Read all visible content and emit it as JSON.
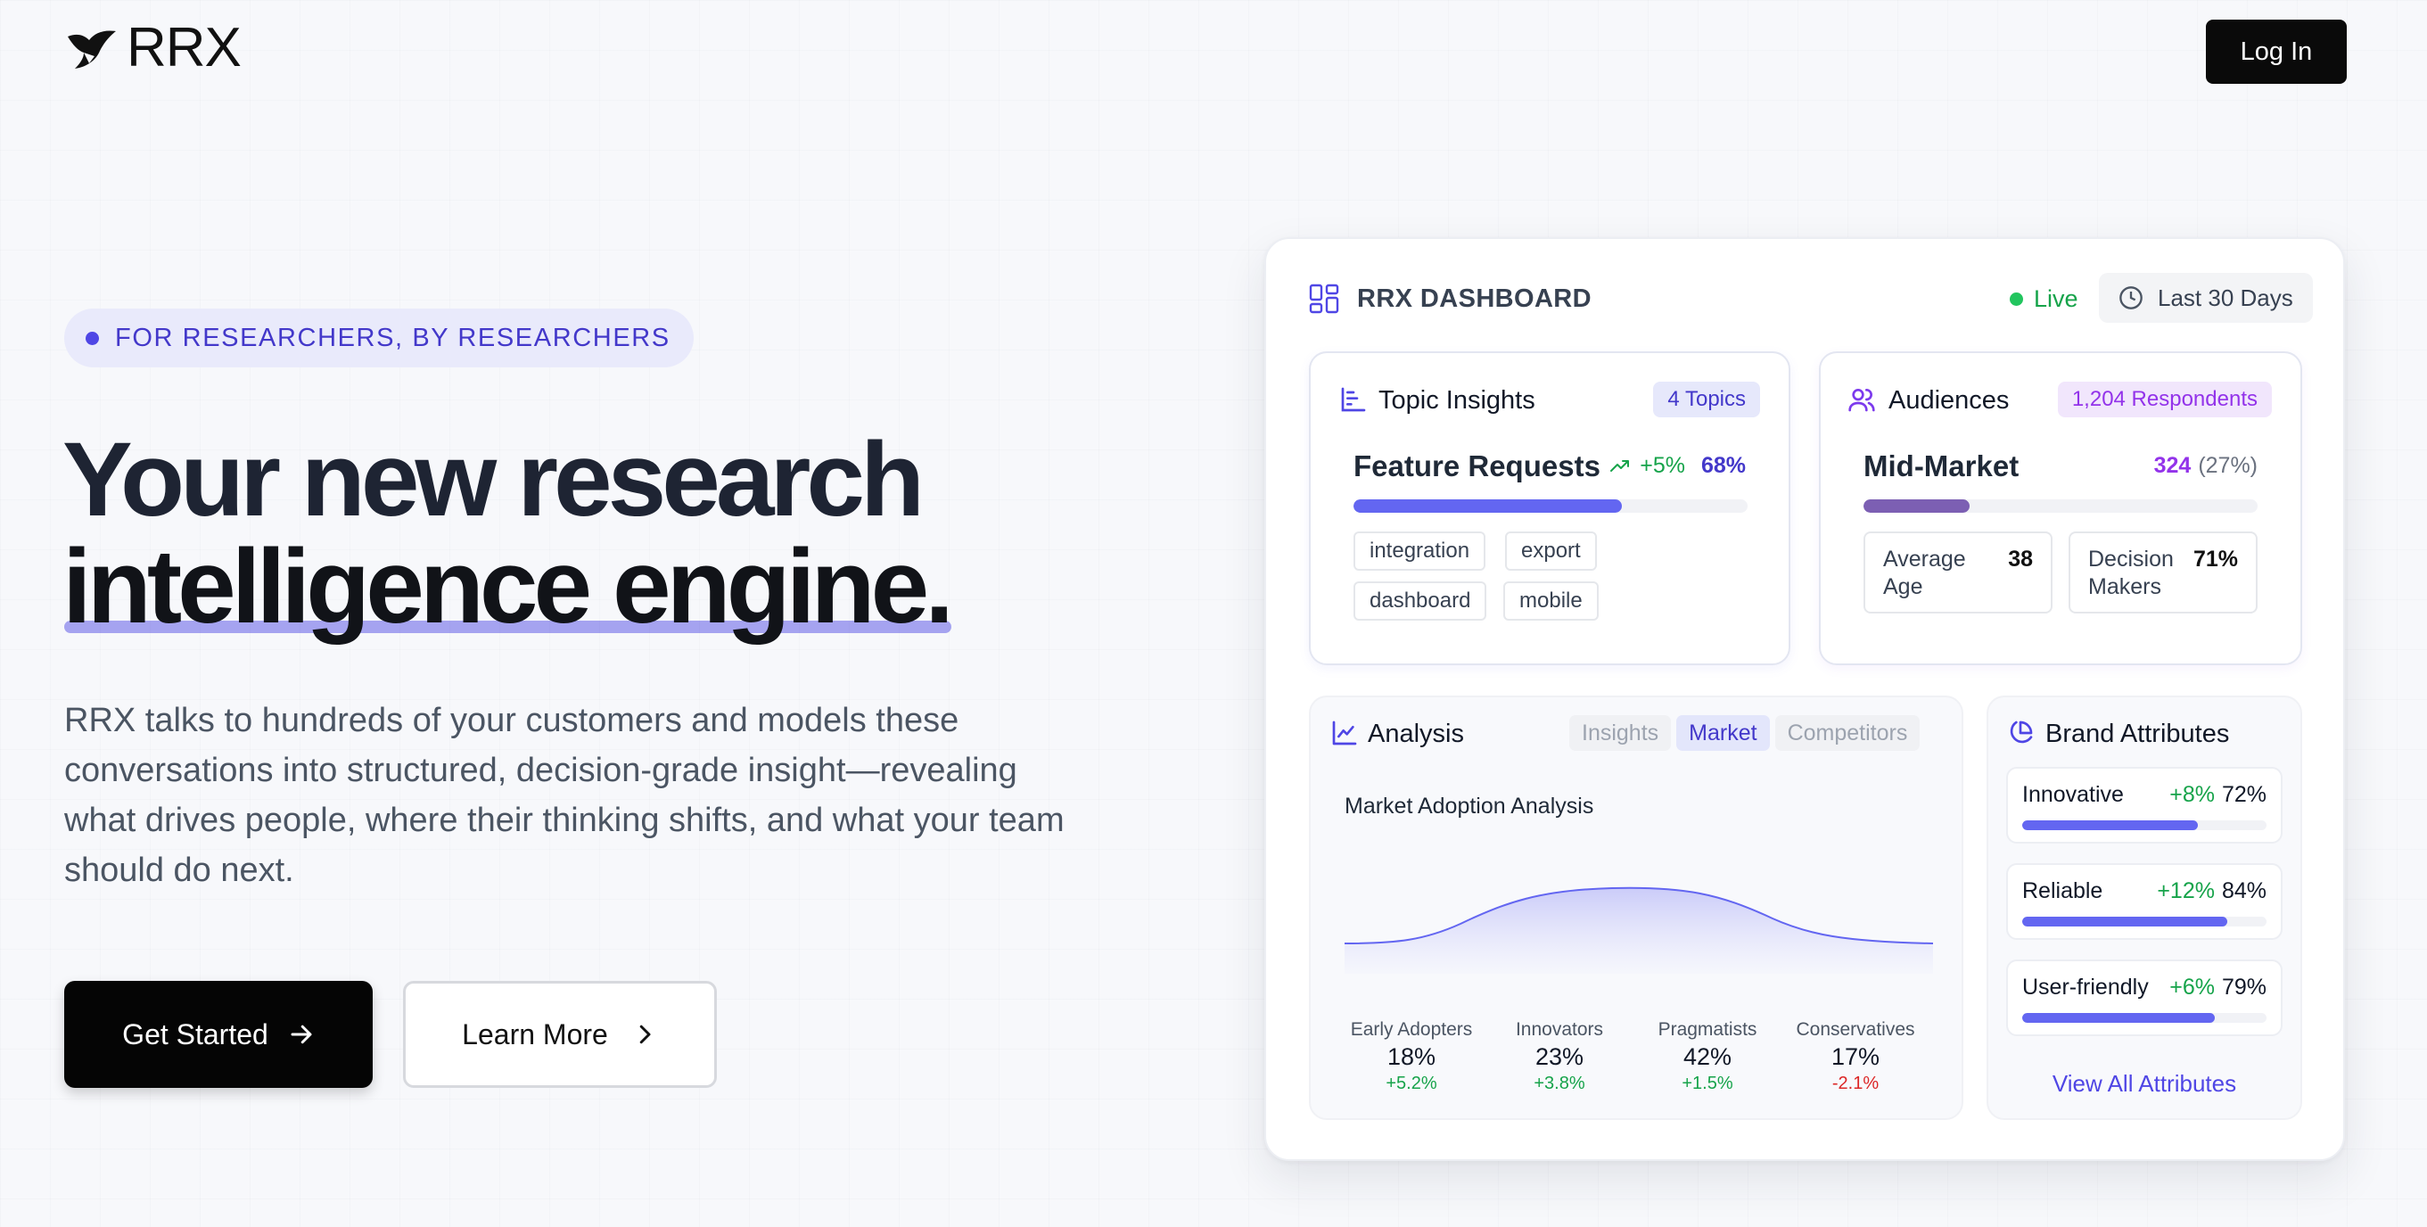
{
  "header": {
    "logo_text": "RRX",
    "login_label": "Log In"
  },
  "hero": {
    "pill": "FOR RESEARCHERS, BY RESEARCHERS",
    "title_line1": "Your new research",
    "title_line2": "intelligence engine.",
    "description": "RRX talks to hundreds of your customers and models these conversations into structured, decision-grade insight—revealing what drives people, where their thinking shifts, and what your team should do next.",
    "primary_cta": "Get Started",
    "secondary_cta": "Learn More"
  },
  "dashboard": {
    "title": "RRX DASHBOARD",
    "live": "Live",
    "range": "Last 30 Days",
    "topic": {
      "title": "Topic Insights",
      "badge": "4 Topics",
      "label": "Feature Requests",
      "change": "+5%",
      "percent": "68%",
      "fill": 0.68,
      "tags": [
        "integration",
        "export",
        "dashboard",
        "mobile"
      ]
    },
    "audiences": {
      "title": "Audiences",
      "badge": "1,204 Respondents",
      "label": "Mid-Market",
      "count": "324",
      "share": "(27%)",
      "fill": 0.27,
      "stats": [
        {
          "label": "Average Age",
          "value": "38"
        },
        {
          "label": "Decision Makers",
          "value": "71%"
        }
      ]
    },
    "analysis": {
      "title": "Analysis",
      "tabs": [
        "Insights",
        "Market",
        "Competitors"
      ],
      "active_tab": "Market",
      "chart_title": "Market Adoption Analysis",
      "segments": [
        {
          "name": "Early Adopters",
          "value": "18%",
          "change": "+5.2%"
        },
        {
          "name": "Innovators",
          "value": "23%",
          "change": "+3.8%"
        },
        {
          "name": "Pragmatists",
          "value": "42%",
          "change": "+1.5%"
        },
        {
          "name": "Conservatives",
          "value": "17%",
          "change": "-2.1%"
        }
      ]
    },
    "brand": {
      "title": "Brand Attributes",
      "attributes": [
        {
          "name": "Innovative",
          "change": "+8%",
          "value": "72%",
          "fill": 0.72
        },
        {
          "name": "Reliable",
          "change": "+12%",
          "value": "84%",
          "fill": 0.84
        },
        {
          "name": "User-friendly",
          "change": "+6%",
          "value": "79%",
          "fill": 0.79
        }
      ],
      "view_all": "View All Attributes"
    },
    "colors": {
      "indigo": "#6366f1",
      "purple": "#7c5fb3",
      "green": "#16a34a",
      "red": "#dc2626"
    }
  }
}
